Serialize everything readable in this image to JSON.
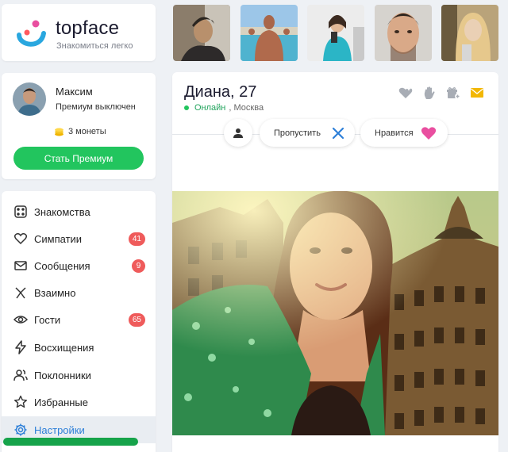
{
  "logo": {
    "brand": "topface",
    "tagline": "Знакомиться легко"
  },
  "user": {
    "name": "Максим",
    "premium_status": "Премиум выключен",
    "coins": "3 монеты",
    "premium_button": "Стать Премиум"
  },
  "nav": [
    {
      "label": "Знакомства",
      "icon": "dice-icon"
    },
    {
      "label": "Симпатии",
      "icon": "heart-icon",
      "badge": "41"
    },
    {
      "label": "Сообщения",
      "icon": "mail-icon",
      "badge": "9"
    },
    {
      "label": "Взаимно",
      "icon": "mutual-arrows-icon"
    },
    {
      "label": "Гости",
      "icon": "eye-icon",
      "badge": "65"
    },
    {
      "label": "Восхищения",
      "icon": "lightning-icon"
    },
    {
      "label": "Поклонники",
      "icon": "fans-icon"
    },
    {
      "label": "Избранные",
      "icon": "star-icon"
    },
    {
      "label": "Настройки",
      "icon": "gear-icon",
      "active": true
    }
  ],
  "profile": {
    "name_age": "Диана, 27",
    "online": "Онлайн",
    "city": ", Москва",
    "actions": {
      "skip": "Пропустить",
      "like": "Нравится"
    }
  },
  "colors": {
    "accent_green": "#22c55e",
    "badge_red": "#ef5b5b",
    "active_blue": "#2d7fd8",
    "like_pink": "#e94fa0",
    "mail_yellow": "#f2b705"
  }
}
